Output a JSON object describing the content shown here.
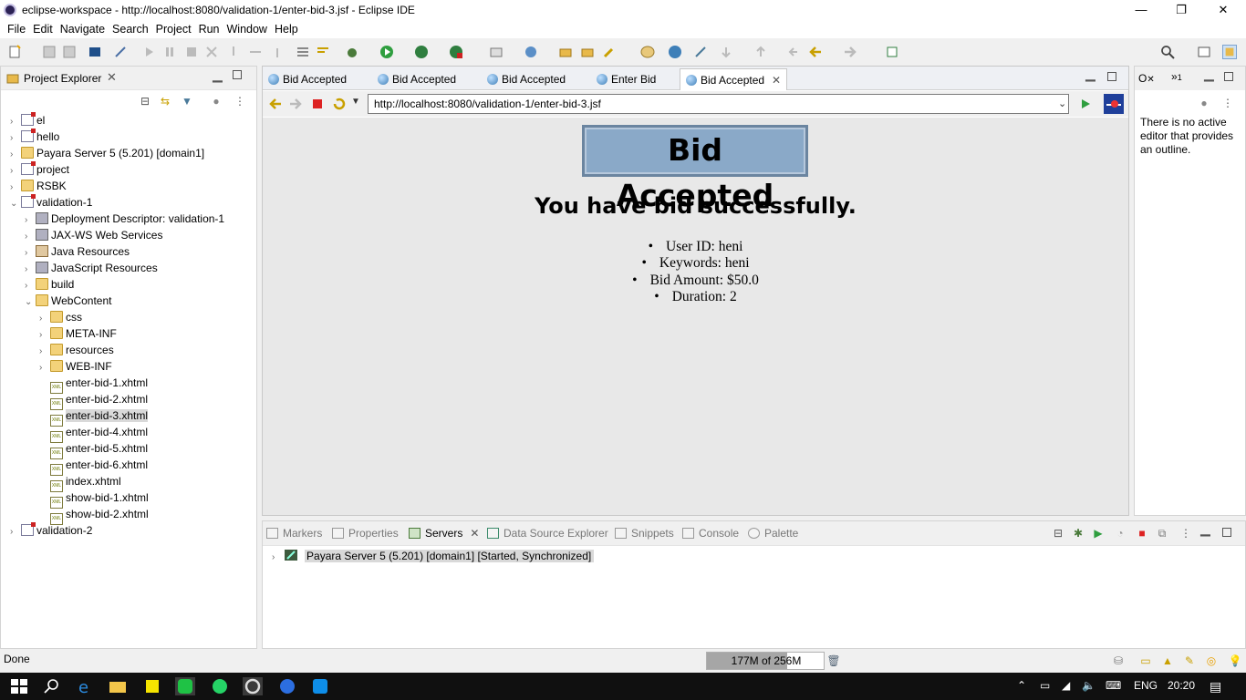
{
  "window": {
    "title": "eclipse-workspace - http://localhost:8080/validation-1/enter-bid-3.jsf - Eclipse IDE",
    "minimize": "—",
    "restore": "❐",
    "close": "✕"
  },
  "menu": [
    "File",
    "Edit",
    "Navigate",
    "Search",
    "Project",
    "Run",
    "Window",
    "Help"
  ],
  "project_explorer": {
    "title": "Project Explorer",
    "items": [
      {
        "label": "el",
        "depth": 0,
        "expanded": false,
        "icon": "project-icon"
      },
      {
        "label": "hello",
        "depth": 0,
        "expanded": false,
        "icon": "project-icon"
      },
      {
        "label": "Payara Server 5 (5.201) [domain1]",
        "depth": 0,
        "expanded": false,
        "icon": "folder-icon"
      },
      {
        "label": "project",
        "depth": 0,
        "expanded": false,
        "icon": "project-icon"
      },
      {
        "label": "RSBK",
        "depth": 0,
        "expanded": false,
        "icon": "folder-icon"
      },
      {
        "label": "validation-1",
        "depth": 0,
        "expanded": true,
        "icon": "project-icon"
      },
      {
        "label": "Deployment Descriptor: validation-1",
        "depth": 1,
        "expanded": false,
        "icon": "descriptor-icon"
      },
      {
        "label": "JAX-WS Web Services",
        "depth": 1,
        "expanded": false,
        "icon": "webservice-icon"
      },
      {
        "label": "Java Resources",
        "depth": 1,
        "expanded": false,
        "icon": "java-icon"
      },
      {
        "label": "JavaScript Resources",
        "depth": 1,
        "expanded": false,
        "icon": "library-icon"
      },
      {
        "label": "build",
        "depth": 1,
        "expanded": false,
        "icon": "folder-icon"
      },
      {
        "label": "WebContent",
        "depth": 1,
        "expanded": true,
        "icon": "folder-icon"
      },
      {
        "label": "css",
        "depth": 2,
        "expanded": false,
        "icon": "folder-icon"
      },
      {
        "label": "META-INF",
        "depth": 2,
        "expanded": false,
        "icon": "folder-icon"
      },
      {
        "label": "resources",
        "depth": 2,
        "expanded": false,
        "icon": "folder-icon"
      },
      {
        "label": "WEB-INF",
        "depth": 2,
        "expanded": false,
        "icon": "folder-icon"
      },
      {
        "label": "enter-bid-1.xhtml",
        "depth": 2,
        "leaf": true,
        "icon": "xhtml-file-icon"
      },
      {
        "label": "enter-bid-2.xhtml",
        "depth": 2,
        "leaf": true,
        "icon": "xhtml-file-icon"
      },
      {
        "label": "enter-bid-3.xhtml",
        "depth": 2,
        "leaf": true,
        "selected": true,
        "icon": "xhtml-file-icon"
      },
      {
        "label": "enter-bid-4.xhtml",
        "depth": 2,
        "leaf": true,
        "icon": "xhtml-file-icon"
      },
      {
        "label": "enter-bid-5.xhtml",
        "depth": 2,
        "leaf": true,
        "icon": "xhtml-file-icon"
      },
      {
        "label": "enter-bid-6.xhtml",
        "depth": 2,
        "leaf": true,
        "icon": "xhtml-file-icon"
      },
      {
        "label": "index.xhtml",
        "depth": 2,
        "leaf": true,
        "icon": "xhtml-file-icon"
      },
      {
        "label": "show-bid-1.xhtml",
        "depth": 2,
        "leaf": true,
        "icon": "xhtml-file-icon"
      },
      {
        "label": "show-bid-2.xhtml",
        "depth": 2,
        "leaf": true,
        "icon": "xhtml-file-icon"
      },
      {
        "label": "validation-2",
        "depth": 0,
        "expanded": false,
        "icon": "project-icon"
      }
    ]
  },
  "editor": {
    "tabs": [
      {
        "label": "Bid Accepted",
        "active": false
      },
      {
        "label": "Bid Accepted",
        "active": false
      },
      {
        "label": "Bid Accepted",
        "active": false
      },
      {
        "label": "Enter Bid",
        "active": false
      },
      {
        "label": "Bid Accepted",
        "active": true
      }
    ],
    "url": "http://localhost:8080/validation-1/enter-bid-3.jsf"
  },
  "page": {
    "heading": "Bid Accepted",
    "subheading": "You have bid successfully.",
    "details": [
      "User ID: heni",
      "Keywords: heni",
      "Bid Amount: $50.0",
      "Duration: 2"
    ]
  },
  "outline": {
    "tab1": "O",
    "tab2": "1",
    "message": "There is no active editor that provides an outline."
  },
  "bottom_panel": {
    "tabs": [
      "Markers",
      "Properties",
      "Servers",
      "Data Source Explorer",
      "Snippets",
      "Console",
      "Palette"
    ],
    "active_tab": "Servers",
    "server_label": "Payara Server 5 (5.201) [domain1]  [Started, Synchronized]"
  },
  "status": {
    "text": "Done",
    "memory": "177M of 256M",
    "memory_fraction": 0.69
  },
  "taskbar": {
    "language": "ENG",
    "time": "20:20"
  },
  "colors": {
    "heading_bg": "#8aa9c8",
    "page_bg": "#e8e8e8",
    "taskbar_bg": "#101010"
  }
}
